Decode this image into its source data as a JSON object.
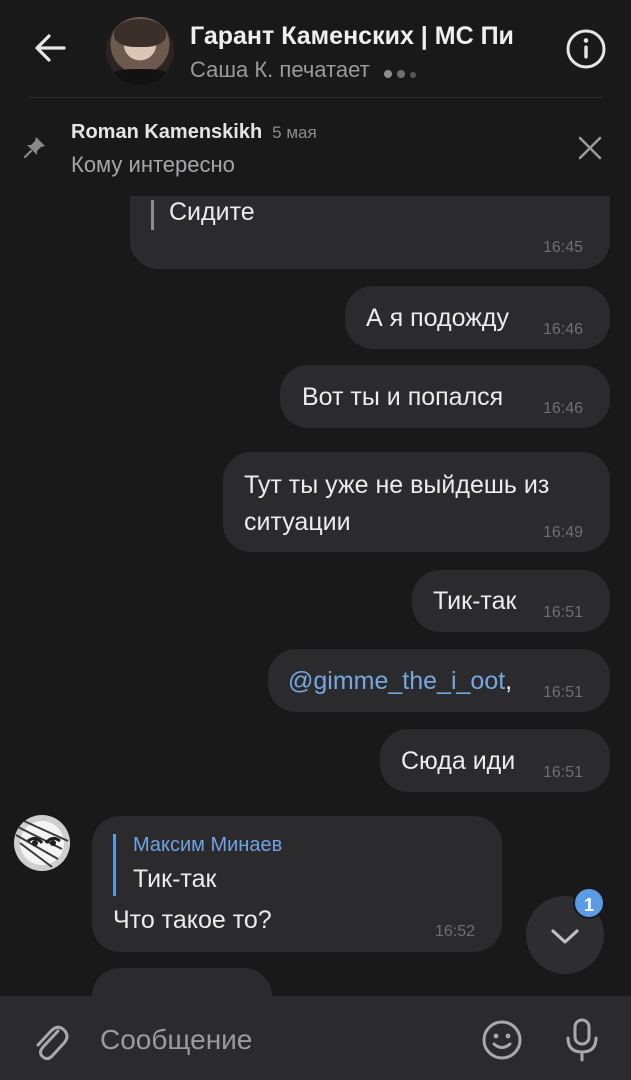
{
  "header": {
    "title": "Гарант Каменских | МС Пи",
    "subtitle": "Саша К. печатает"
  },
  "pinned": {
    "author": "Roman Kamenskikh",
    "date": "5 мая",
    "text": "Кому интересно"
  },
  "messages": [
    {
      "text": "Сидите",
      "time": "16:45"
    },
    {
      "text": "А я подожду",
      "time": "16:46"
    },
    {
      "text": "Вот ты и попался",
      "time": "16:46"
    },
    {
      "line1": "Тут ты уже не выйдешь из",
      "line2": "ситуации",
      "time": "16:49"
    },
    {
      "text": "Тик-так",
      "time": "16:51"
    },
    {
      "mention": "@gimme_the_i_oot",
      "text": ",",
      "time": "16:51"
    },
    {
      "text": "Сюда иди",
      "time": "16:51"
    }
  ],
  "incoming": {
    "reply_author": "Максим Минаев",
    "reply_text": "Тик-так",
    "text": "Что такое то?",
    "time": "16:52"
  },
  "scroll_badge": "1",
  "composer": {
    "placeholder": "Сообщение"
  },
  "colors": {
    "background": "#19191a",
    "bubble": "#2b2b2d",
    "accent": "#5b9be6",
    "mention": "#76a7e0"
  }
}
